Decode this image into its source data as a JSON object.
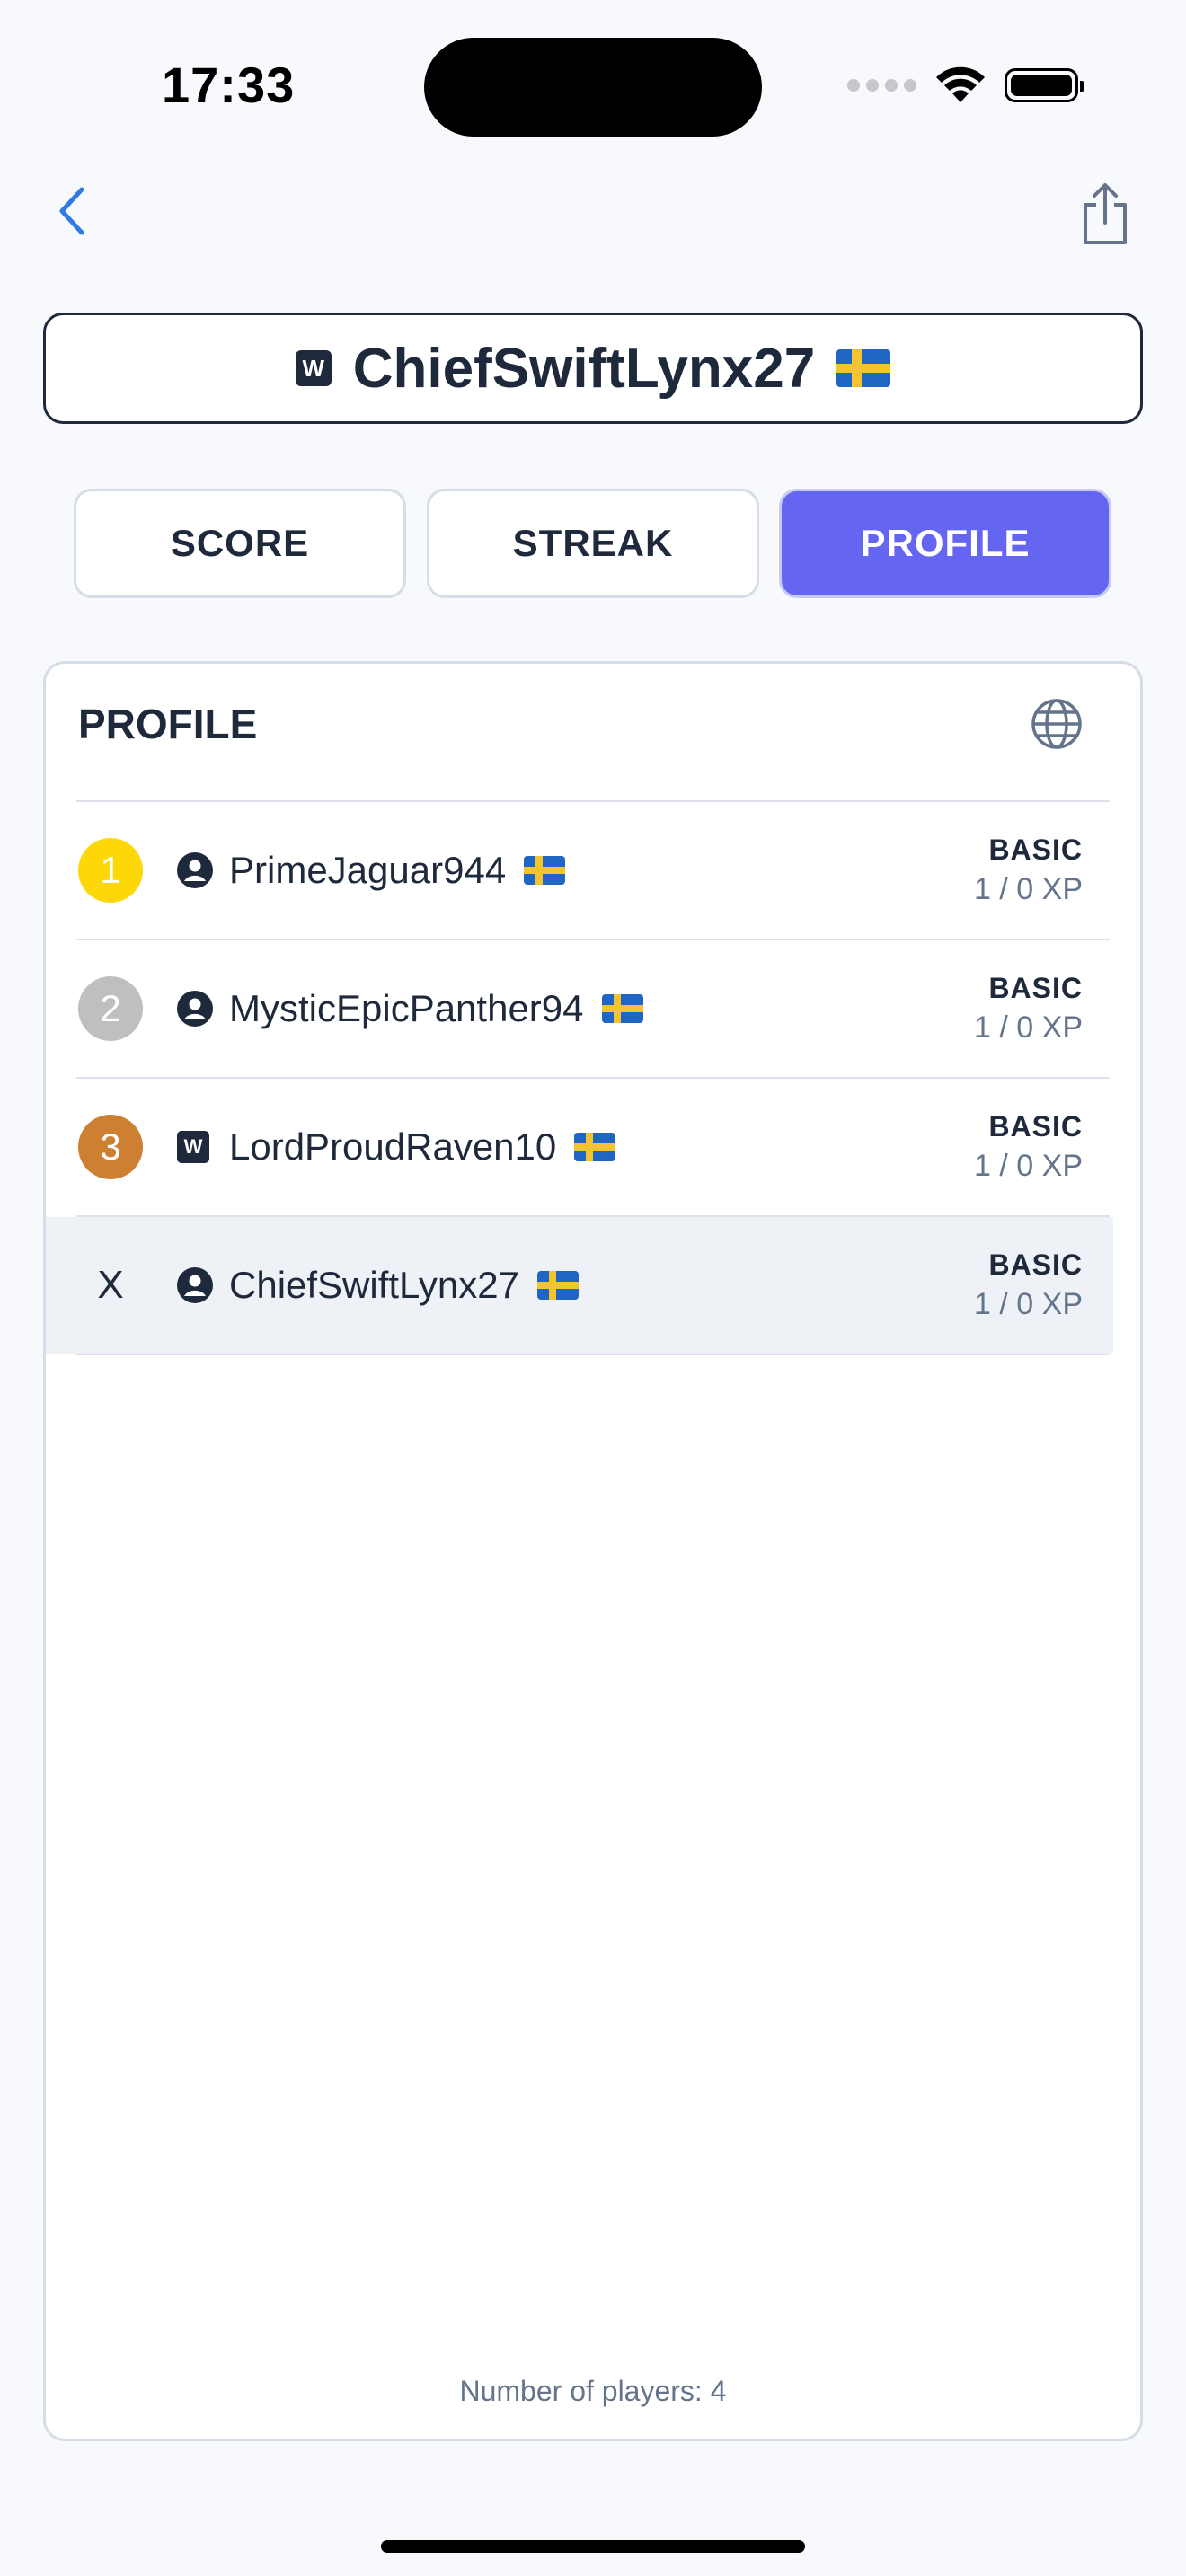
{
  "status_bar": {
    "time": "17:33"
  },
  "header": {
    "player_name": "ChiefSwiftLynx27"
  },
  "tabs": [
    {
      "label": "SCORE",
      "active": false
    },
    {
      "label": "STREAK",
      "active": false
    },
    {
      "label": "PROFILE",
      "active": true
    }
  ],
  "card": {
    "title": "PROFILE",
    "footer": "Number of players: 4"
  },
  "rows": [
    {
      "rank": "1",
      "rank_color": "#fdd708",
      "avatar": "person-icon",
      "name": "PrimeJaguar944",
      "level": "BASIC",
      "xp": "1 / 0 XP"
    },
    {
      "rank": "2",
      "rank_color": "#bfbfbf",
      "avatar": "person-icon",
      "name": "MysticEpicPanther94",
      "level": "BASIC",
      "xp": "1 / 0 XP"
    },
    {
      "rank": "3",
      "rank_color": "#cd7f32",
      "avatar": "w-badge-icon",
      "name": "LordProudRaven10",
      "level": "BASIC",
      "xp": "1 / 0 XP"
    },
    {
      "rank": "X",
      "rank_color": "",
      "avatar": "person-icon",
      "name": "ChiefSwiftLynx27",
      "level": "BASIC",
      "xp": "1 / 0 XP"
    }
  ],
  "badges": {
    "w_letter": "W"
  },
  "colors": {
    "accent": "#6466f1",
    "text": "#1e293b",
    "back_icon": "#2f7ae5"
  }
}
